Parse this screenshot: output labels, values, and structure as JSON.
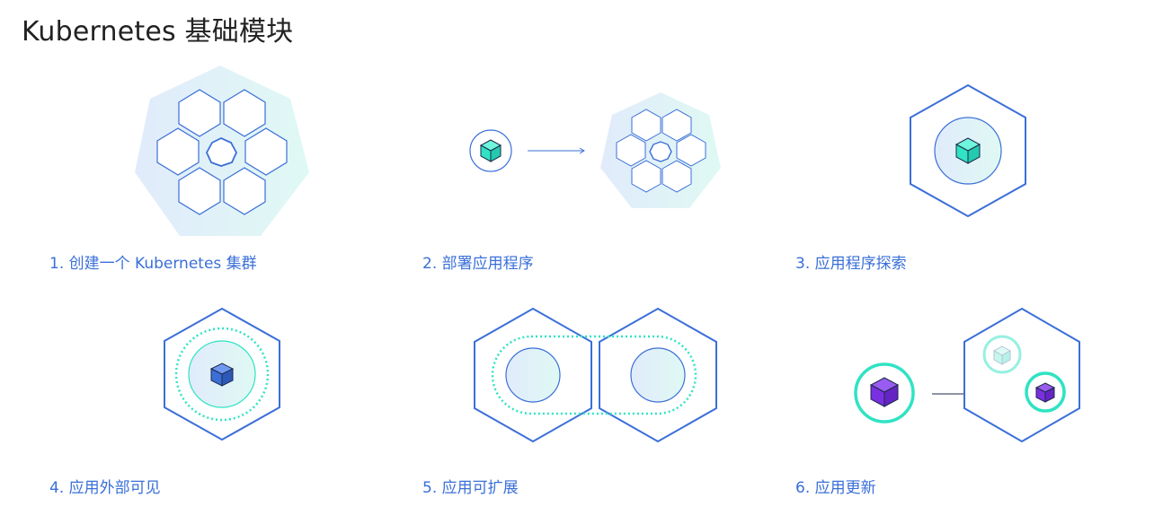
{
  "page": {
    "title": "Kubernetes 基础模块"
  },
  "colors": {
    "outline_blue": "#3b6fd8",
    "teal": "#2fe3c3",
    "teal_face": "#3ef0cf",
    "purple": "#7a2fe0",
    "link_blue": "#3a6fd8",
    "title_text": "#222222",
    "blob_start": "#e1ebfb",
    "blob_end": "#dff9f4"
  },
  "modules": [
    {
      "label": "1. 创建一个 Kubernetes 集群",
      "illustration": "cluster-icon"
    },
    {
      "label": "2. 部署应用程序",
      "illustration": "deploy-app-icon"
    },
    {
      "label": "3. 应用程序探索",
      "illustration": "explore-app-icon"
    },
    {
      "label": "4. 应用外部可见",
      "illustration": "expose-app-icon"
    },
    {
      "label": "5. 应用可扩展",
      "illustration": "scale-app-icon"
    },
    {
      "label": "6. 应用更新",
      "illustration": "update-app-icon"
    }
  ]
}
